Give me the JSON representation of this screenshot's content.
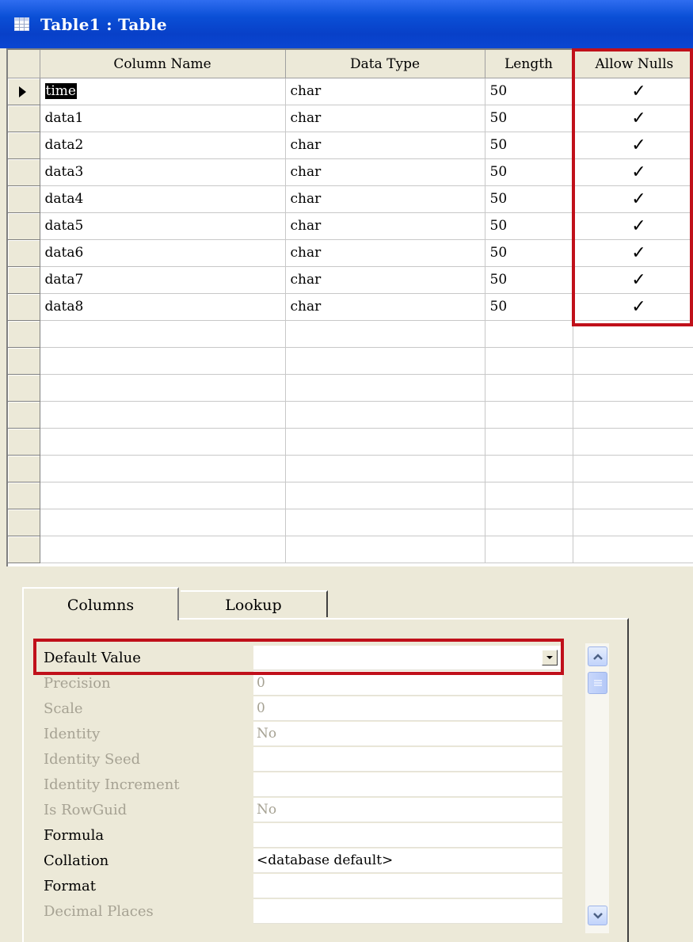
{
  "window": {
    "title": "Table1 : Table",
    "icon": "table-icon"
  },
  "grid": {
    "headers": {
      "column_name": "Column Name",
      "data_type": "Data Type",
      "length": "Length",
      "allow_nulls": "Allow Nulls"
    },
    "rows": [
      {
        "name": "time",
        "type": "char",
        "length": "50",
        "allow_nulls": "✓"
      },
      {
        "name": "data1",
        "type": "char",
        "length": "50",
        "allow_nulls": "✓"
      },
      {
        "name": "data2",
        "type": "char",
        "length": "50",
        "allow_nulls": "✓"
      },
      {
        "name": "data3",
        "type": "char",
        "length": "50",
        "allow_nulls": "✓"
      },
      {
        "name": "data4",
        "type": "char",
        "length": "50",
        "allow_nulls": "✓"
      },
      {
        "name": "data5",
        "type": "char",
        "length": "50",
        "allow_nulls": "✓"
      },
      {
        "name": "data6",
        "type": "char",
        "length": "50",
        "allow_nulls": "✓"
      },
      {
        "name": "data7",
        "type": "char",
        "length": "50",
        "allow_nulls": "✓"
      },
      {
        "name": "data8",
        "type": "char",
        "length": "50",
        "allow_nulls": "✓"
      }
    ],
    "empty_rows": 9,
    "current_row_indicator": "row-pointer-icon"
  },
  "tabs": [
    {
      "label": "Columns",
      "active": true
    },
    {
      "label": "Lookup",
      "active": false
    }
  ],
  "properties": [
    {
      "label": "Default Value",
      "value": "",
      "disabled": false,
      "dropdown": true
    },
    {
      "label": "Precision",
      "value": "0",
      "disabled": true
    },
    {
      "label": "Scale",
      "value": "0",
      "disabled": true
    },
    {
      "label": "Identity",
      "value": "No",
      "disabled": true
    },
    {
      "label": "Identity Seed",
      "value": "",
      "disabled": true
    },
    {
      "label": "Identity Increment",
      "value": "",
      "disabled": true
    },
    {
      "label": "Is RowGuid",
      "value": "No",
      "disabled": true
    },
    {
      "label": "Formula",
      "value": "",
      "disabled": false
    },
    {
      "label": "Collation",
      "value": "<database default>",
      "disabled": false
    },
    {
      "label": "Format",
      "value": "",
      "disabled": false
    },
    {
      "label": "Decimal Places",
      "value": "",
      "disabled": true
    }
  ],
  "colors": {
    "titlebar": "#0a4fd6",
    "highlight": "#c0101a",
    "disabled_text": "#a6a293",
    "chrome": "#ece9d8"
  }
}
